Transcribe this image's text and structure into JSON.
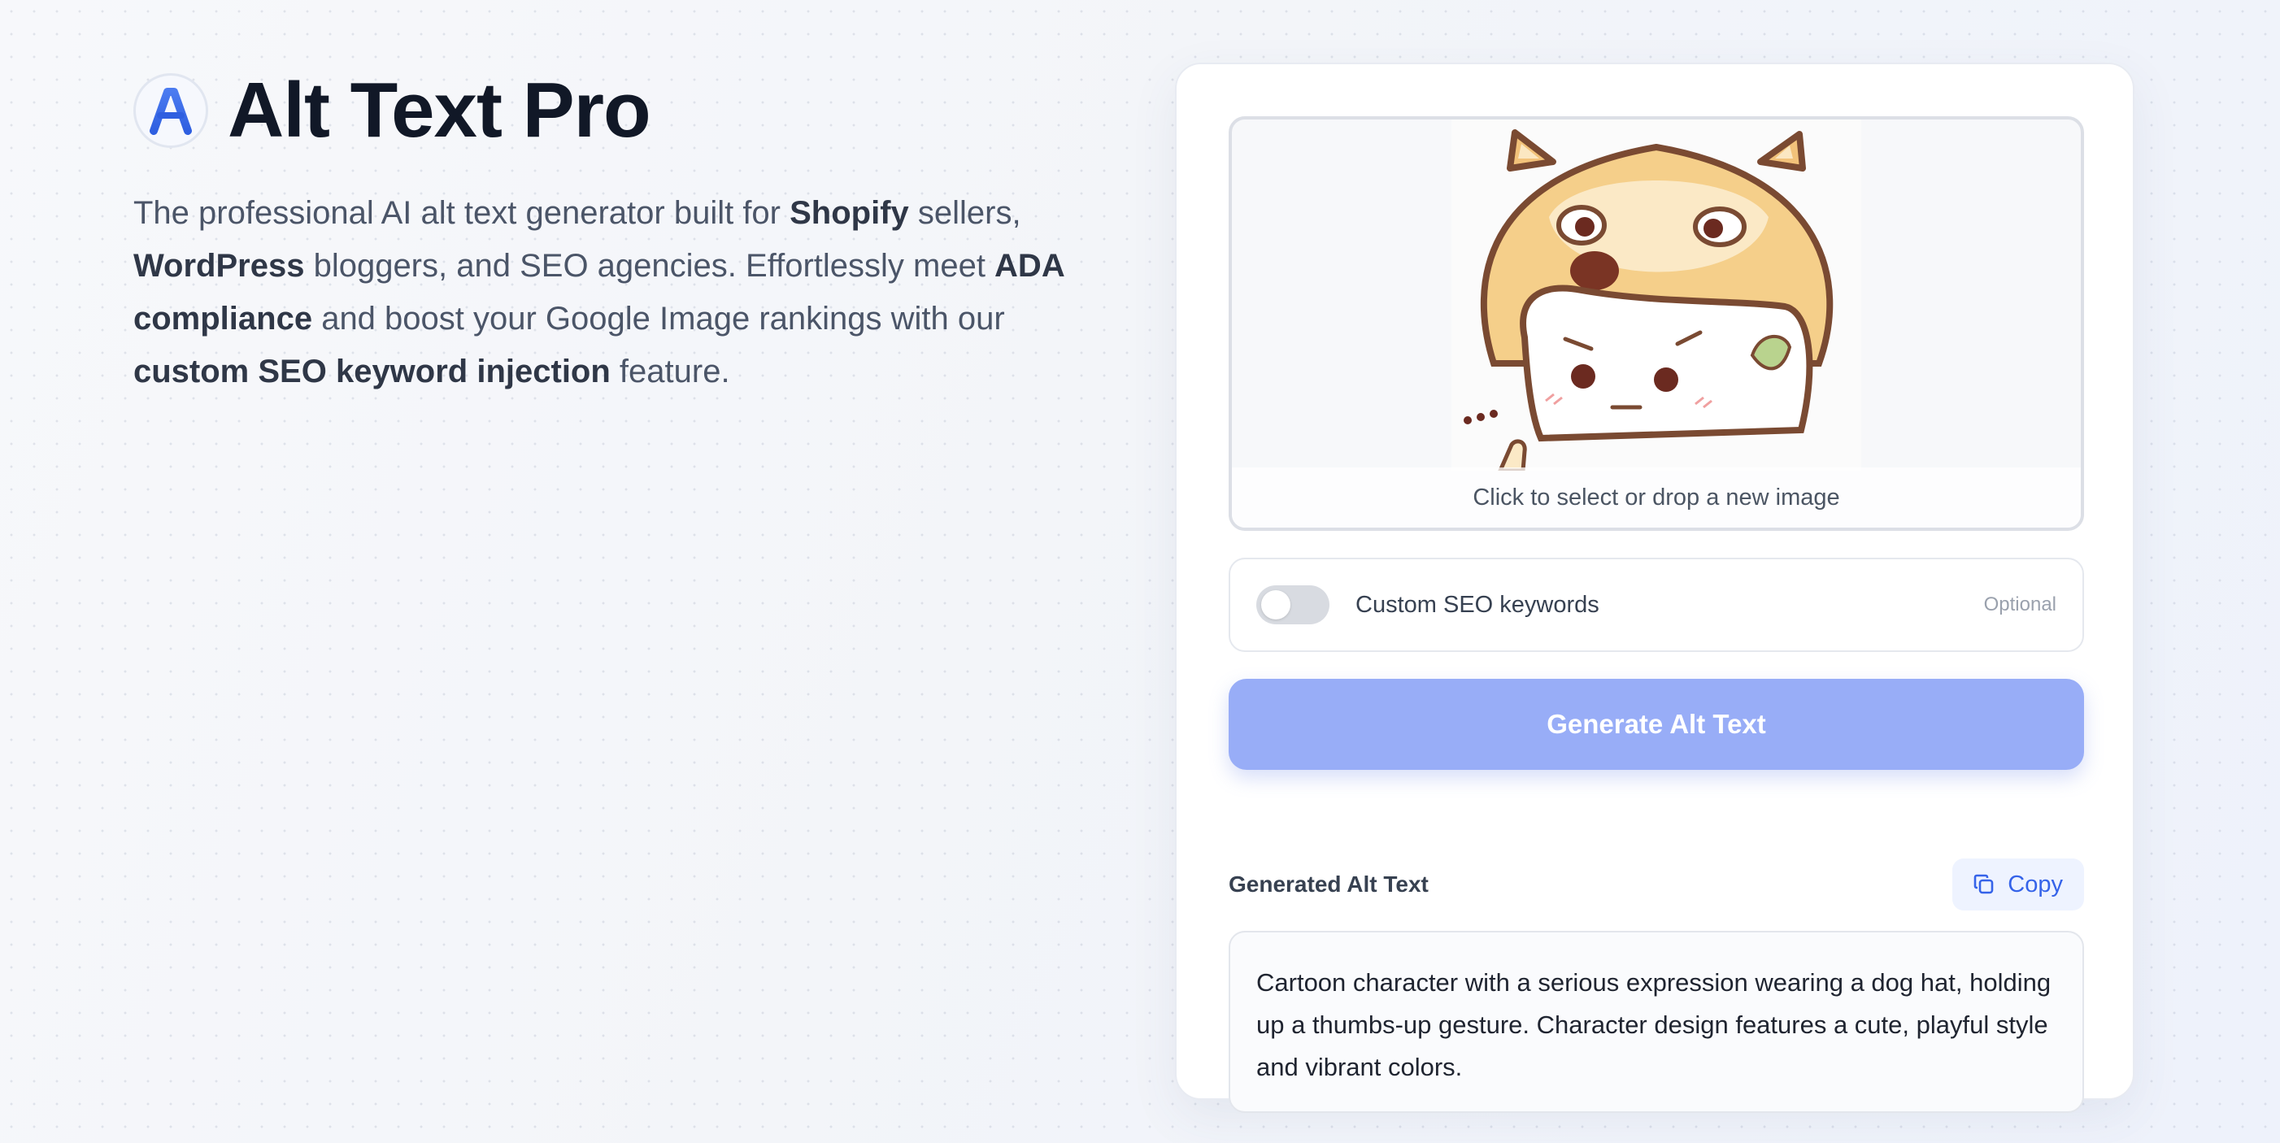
{
  "app": {
    "title": "Alt Text Pro",
    "logo_icon": "letter-a-logo-icon",
    "accent_color": "#3563e9"
  },
  "hero": {
    "tagline": [
      {
        "text": "The professional AI alt text generator built for ",
        "bold": false
      },
      {
        "text": "Shopify",
        "bold": true
      },
      {
        "text": " sellers, ",
        "bold": false
      },
      {
        "text": "WordPress",
        "bold": true
      },
      {
        "text": " bloggers, and SEO agencies. Effortlessly meet ",
        "bold": false
      },
      {
        "text": "ADA compliance",
        "bold": true
      },
      {
        "text": " and boost your Google Image rankings with our ",
        "bold": false
      },
      {
        "text": "custom SEO keyword injection",
        "bold": true
      },
      {
        "text": " feature.",
        "bold": false
      }
    ]
  },
  "uploader": {
    "hint": "Click to select or drop a new image",
    "preview_icon": "shiba-dog-hat-cartoon-image"
  },
  "seo": {
    "label": "Custom SEO keywords",
    "optional_label": "Optional",
    "enabled": false
  },
  "actions": {
    "generate_label": "Generate Alt Text",
    "generate_color": "#98adf7"
  },
  "result": {
    "title": "Generated Alt Text",
    "copy_label": "Copy",
    "copy_icon": "copy-icon",
    "text": "Cartoon character with a serious expression wearing a dog hat, holding up a thumbs-up gesture. Character design features a cute, playful style and vibrant colors."
  }
}
